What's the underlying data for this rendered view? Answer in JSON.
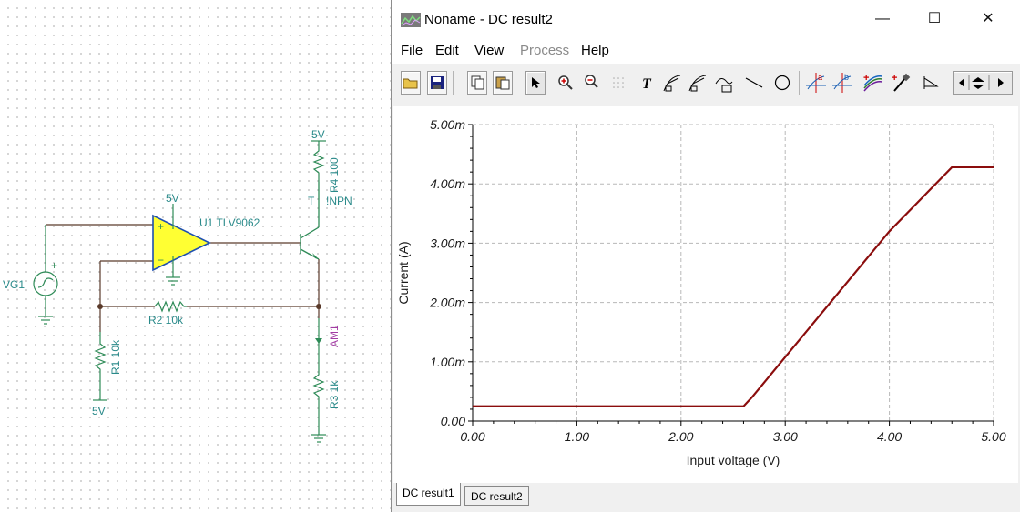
{
  "schematic": {
    "vg1": "VG1",
    "opamp": "U1 TLV9062",
    "opamp_supply": "5V",
    "opamp_plus": "+",
    "opamp_minus": "−",
    "r2": "R2 10k",
    "r1": "R1 10k",
    "r1_supply": "5V",
    "r4": "R4 100",
    "r4_supply": "5V",
    "transistor_t": "T",
    "transistor": "!NPN",
    "ammeter": "AM1",
    "r3": "R3 1k",
    "source_plus": "+"
  },
  "window": {
    "title": "Noname - DC result2",
    "minimize": "—",
    "maximize": "☐",
    "close": "✕"
  },
  "menu": {
    "file": "File",
    "edit": "Edit",
    "view": "View",
    "process": "Process",
    "help": "Help"
  },
  "toolbar": [
    "open-folder-icon",
    "save-icon",
    "copy-icon",
    "paste-icon",
    "pointer-icon",
    "zoom-in-icon",
    "zoom-100-icon",
    "grid-icon",
    "text-icon",
    "curve-label-icon",
    "curve-label-2-icon",
    "curve-label-3-icon",
    "line-icon",
    "circle-icon",
    "cursor-a-icon",
    "cursor-b-icon",
    "add-curve-icon",
    "probe-icon",
    "marker-icon",
    "scroll-arrows-icon"
  ],
  "tabs": [
    {
      "label": "DC result1",
      "active": true
    },
    {
      "label": "DC result2",
      "active": false
    }
  ],
  "colors": {
    "curve": "#8b0d0d",
    "schematic_wire": "#2e8b57",
    "opamp_fill": "#ffff33",
    "schematic_text": "#2a8a8a",
    "ammeter_text": "#a23aa3"
  },
  "chart_data": {
    "type": "line",
    "xlabel": "Input voltage (V)",
    "ylabel": "Current (A)",
    "xlim": [
      0,
      5
    ],
    "ylim": [
      0,
      0.005
    ],
    "x_ticks": [
      "0.00",
      "1.00",
      "2.00",
      "3.00",
      "4.00",
      "5.00"
    ],
    "y_ticks": [
      "0.00",
      "1.00m",
      "2.00m",
      "3.00m",
      "4.00m",
      "5.00m"
    ],
    "grid": true,
    "series": [
      {
        "color": "#8b0d0d",
        "x": [
          0,
          2.6,
          2.68,
          4.0,
          4.6,
          5.0
        ],
        "y": [
          0.00025,
          0.00025,
          0.0004,
          0.0032,
          0.00428,
          0.00428
        ]
      }
    ]
  }
}
